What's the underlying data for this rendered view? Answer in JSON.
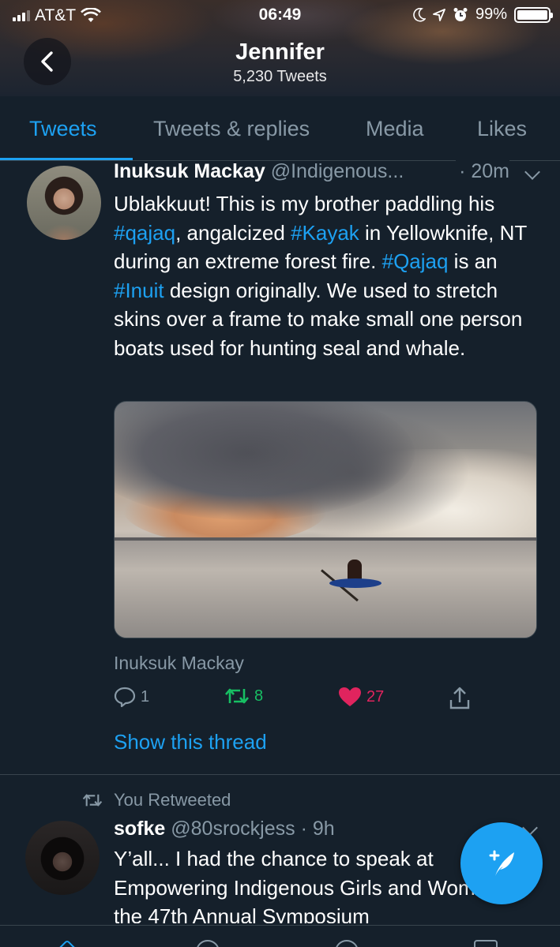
{
  "status_bar": {
    "carrier": "AT&T",
    "time": "06:49",
    "battery": "99%",
    "battery_level": 0.99
  },
  "header": {
    "name": "Jennifer",
    "tweet_count": "5,230 Tweets"
  },
  "tabs": [
    {
      "label": "Tweets",
      "active": true
    },
    {
      "label": "Tweets & replies",
      "active": false
    },
    {
      "label": "Media",
      "active": false
    },
    {
      "label": "Likes",
      "active": false
    }
  ],
  "tweets": [
    {
      "author": "Inuksuk Mackay",
      "handle": "@Indigenous...",
      "time": "· 20m",
      "text_parts": [
        {
          "t": "Ublakkuut! This is my brother paddling his ",
          "tag": false
        },
        {
          "t": "#qajaq",
          "tag": true
        },
        {
          "t": ", angalcized ",
          "tag": false
        },
        {
          "t": "#Kayak",
          "tag": true
        },
        {
          "t": " in Yellowknife, NT during an extreme forest fire. ",
          "tag": false
        },
        {
          "t": "#Qajaq",
          "tag": true
        },
        {
          "t": " is an ",
          "tag": false
        },
        {
          "t": "#Inuit",
          "tag": true
        },
        {
          "t": " design originally. We used to stretch skins over a frame to make small one person boats used for hunting seal and whale.",
          "tag": false
        }
      ],
      "media_caption": "Inuksuk Mackay",
      "replies": "1",
      "retweets": "8",
      "likes": "27",
      "show_thread": "Show this thread"
    },
    {
      "retweet_note": "You Retweeted",
      "author": "sofke",
      "handle": "@80srockjess",
      "time": "· 9h",
      "text": "Y’all... I had the chance to speak at Empowering Indigenous Girls and Women at the 47th Annual Symposium"
    }
  ],
  "colors": {
    "background": "#15202b",
    "accent": "#1da1f2",
    "retweet": "#17bf63",
    "like": "#e0245e",
    "muted": "#8899a6"
  }
}
